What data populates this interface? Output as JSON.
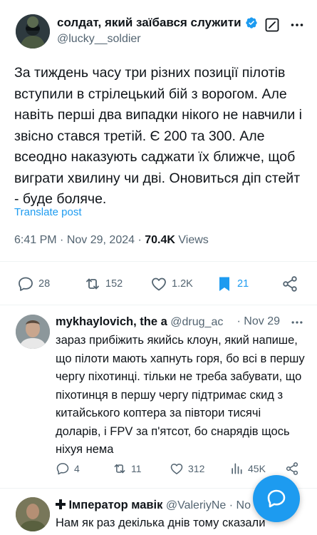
{
  "tweet": {
    "author_name": "солдат, який заїбався служити",
    "author_handle": "@lucky__soldier",
    "text": "За тиждень часу три різних позиції пілотів вступили в стрілецький бій з ворогом. Але навіть перші два випадки нікого не навчили і звісно стався третій. Є 200 та 300. Але всеодно наказують саджати їх ближче, щоб виграти хвилину чи дві. Оновиться діп стейт - буде боляче.",
    "translate_label": "Translate post",
    "time": "6:41 PM",
    "date": "Nov 29, 2024",
    "views_count": "70.4K",
    "views_label": "Views",
    "replies": "28",
    "reposts": "152",
    "likes": "1.2K",
    "bookmarks": "21"
  },
  "reply1": {
    "name": "mykhaylovich, the a",
    "handle": "@drug_ac",
    "time": "· Nov 29",
    "text": "зараз прибіжить якийсь клоун, який напише, що пілоти мають хапнуть горя, бо всі в першу чергу піхотинці. тільки не треба забувати, що піхотинця в першу чергу підтримає скид з китайського коптера за півтори тисячі доларів, і FPV за п'ятсот, бо снарядів щось ніхуя нема",
    "replies": "4",
    "reposts": "11",
    "likes": "312",
    "views": "45K"
  },
  "reply2": {
    "name": "Імператор мавік",
    "handle": "@ValeriyNe",
    "time": "· No",
    "text": "Нам як раз декілька днів тому сказали"
  },
  "colors": {
    "accent": "#1d9bf0",
    "text": "#0f1419",
    "muted": "#536471",
    "divider": "#eff3f4"
  }
}
